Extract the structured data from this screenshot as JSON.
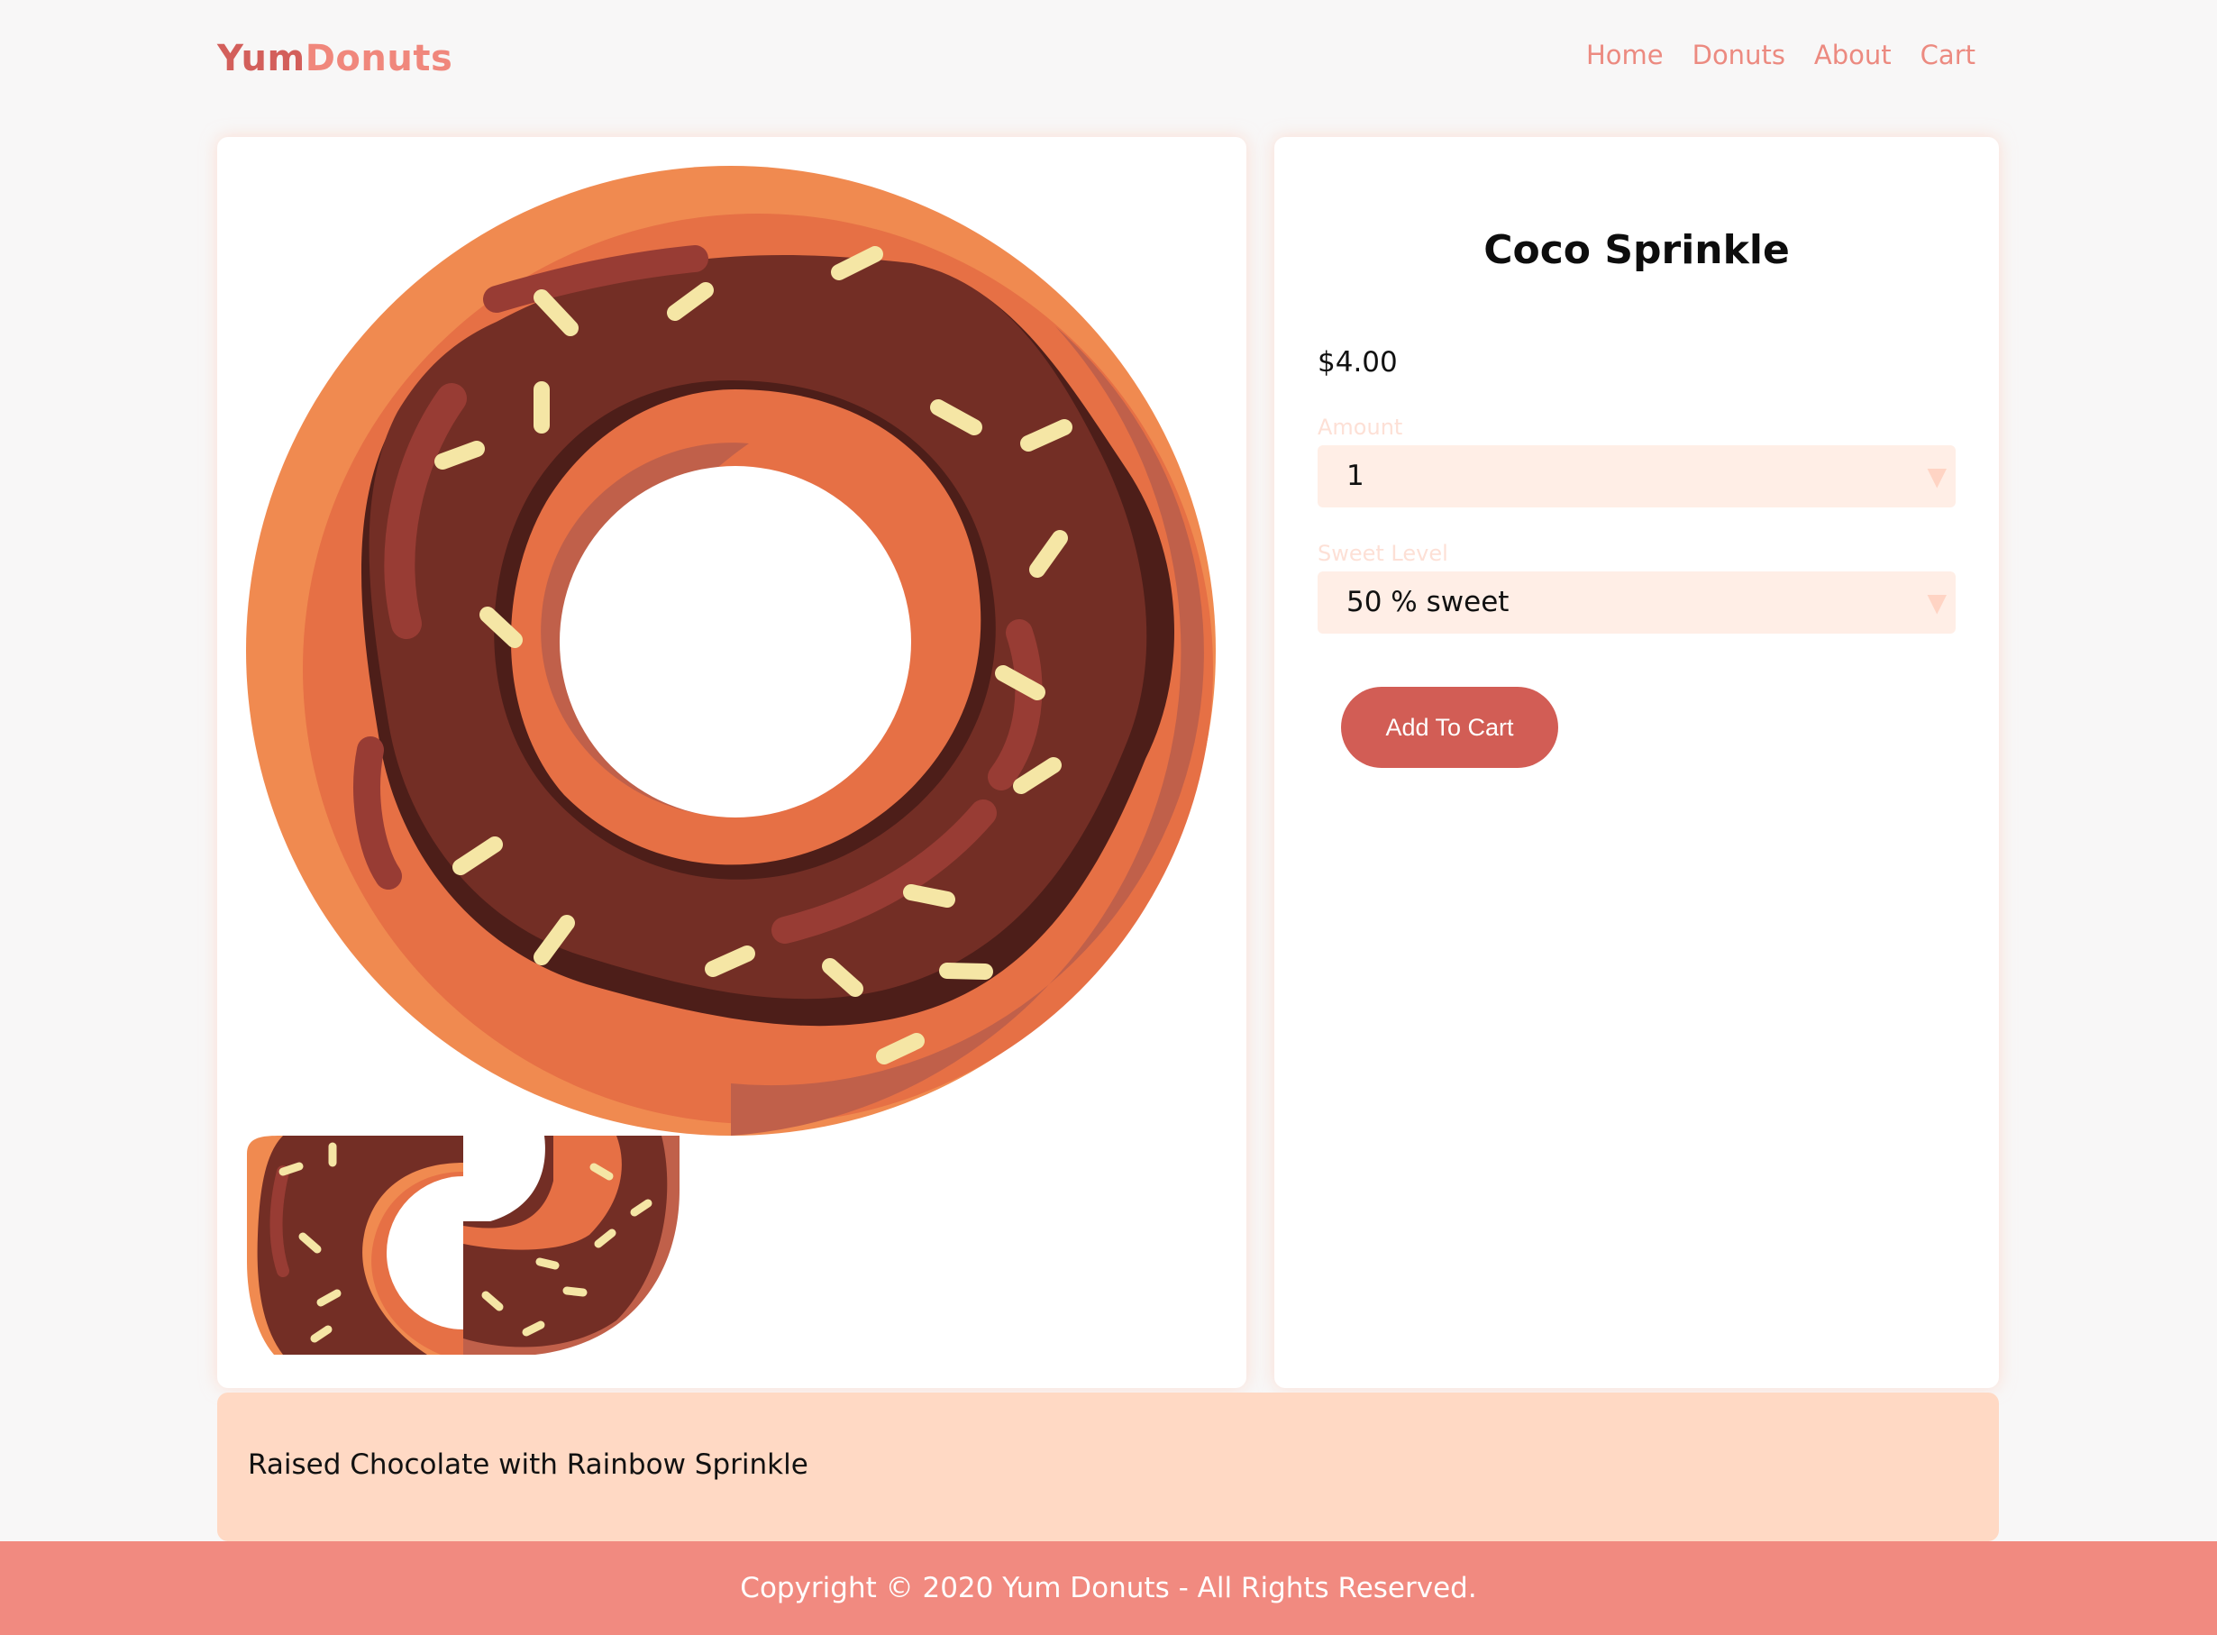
{
  "brand": {
    "yum": "Yum",
    "donuts": "Donuts"
  },
  "nav": {
    "home": "Home",
    "donuts": "Donuts",
    "about": "About",
    "cart": "Cart"
  },
  "product": {
    "name": "Coco Sprinkle",
    "price": "$4.00",
    "amount_label": "Amount",
    "amount_value": "1",
    "sweet_label": "Sweet Level",
    "sweet_value": "50 % sweet",
    "add_to_cart": "Add To Cart",
    "description": "Raised Chocolate with Rainbow Sprinkle"
  },
  "icons": {
    "dropdown": "triangle-down-icon"
  },
  "footer": {
    "copyright": "Copyright © 2020 Yum Donuts - All Rights Reserved."
  },
  "colors": {
    "accent": "#d25d55",
    "nav_link": "#ec8a80",
    "footer_bg": "#f18a80",
    "description_bg": "#ffd9c4",
    "select_bg": "#ffeee6"
  }
}
